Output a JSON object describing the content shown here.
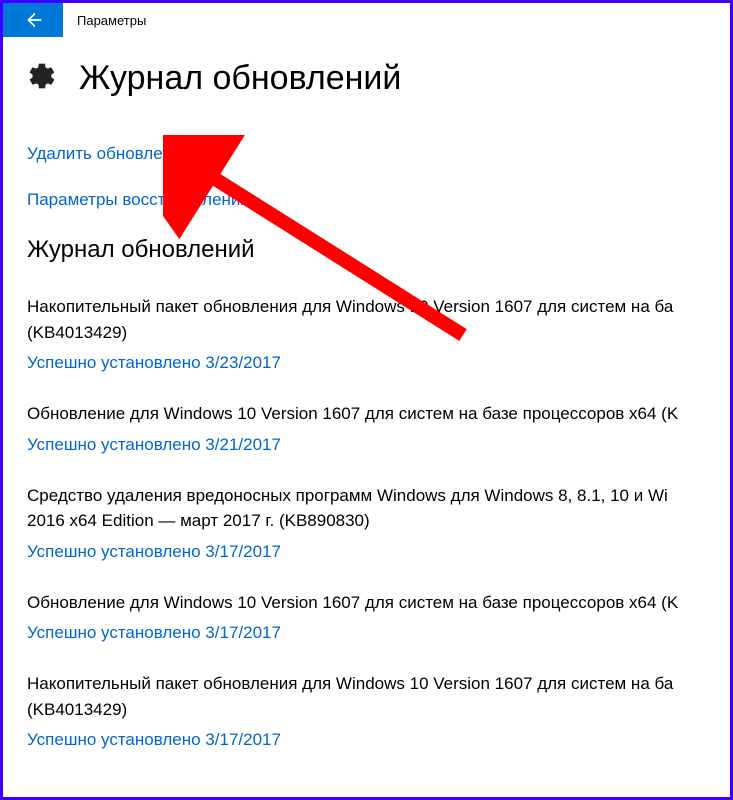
{
  "titlebar": {
    "text": "Параметры"
  },
  "page": {
    "title": "Журнал обновлений"
  },
  "links": {
    "uninstall": "Удалить обновления",
    "recovery": "Параметры восстановления"
  },
  "section": {
    "title": "Журнал обновлений"
  },
  "updates": [
    {
      "name": "Накопительный пакет обновления для Windows 10 Version 1607 для систем на ба (KB4013429)",
      "status": "Успешно установлено 3/23/2017"
    },
    {
      "name": "Обновление для Windows 10 Version 1607 для систем на базе процессоров x64 (K",
      "status": "Успешно установлено 3/21/2017"
    },
    {
      "name": "Средство удаления вредоносных программ Windows для Windows 8, 8.1, 10 и Wi 2016 x64 Edition — март 2017 г. (KB890830)",
      "status": "Успешно установлено 3/17/2017"
    },
    {
      "name": "Обновление для Windows 10 Version 1607 для систем на базе процессоров x64 (K",
      "status": "Успешно установлено 3/17/2017"
    },
    {
      "name": "Накопительный пакет обновления для Windows 10 Version 1607 для систем на ба (KB4013429)",
      "status": "Успешно установлено 3/17/2017"
    }
  ]
}
